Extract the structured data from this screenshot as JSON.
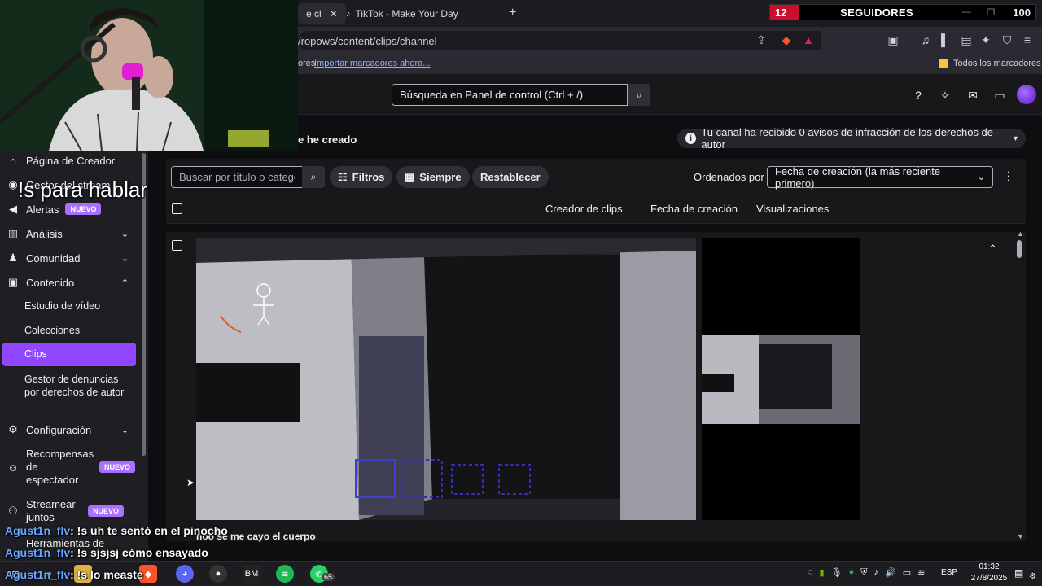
{
  "browser": {
    "tabs": [
      {
        "label": "e cl",
        "close": "✕"
      },
      {
        "label": "TikTok - Make Your Day"
      }
    ],
    "new_tab": "+",
    "url": "/ropows/content/clips/channel",
    "bookmarks_prefix": "ores",
    "bookmarks_import": "Importar marcadores ahora...",
    "bookmarks_all": "Todos los marcadores"
  },
  "followers_widget": {
    "count": "12",
    "label": "SEGUIDORES",
    "goal": "100",
    "minimize": "—",
    "restore": "❐"
  },
  "header": {
    "search_placeholder": "Búsqueda en Panel de control (Ctrl + /)"
  },
  "sidebar": {
    "items": [
      {
        "label": "Página de Creador",
        "icon": "home-icon"
      },
      {
        "label": "Gestor del stream",
        "icon": "broadcast-icon"
      },
      {
        "label": "Alertas",
        "icon": "megaphone-icon",
        "badge": "NUEVO"
      },
      {
        "label": "Análisis",
        "icon": "chart-icon"
      },
      {
        "label": "Comunidad",
        "icon": "community-icon"
      },
      {
        "label": "Contenido",
        "icon": "content-icon"
      }
    ],
    "content_sub": [
      "Estudio de vídeo",
      "Colecciones",
      "Clips",
      "Gestor de denuncias por derechos de autor"
    ],
    "config": "Configuración",
    "rewards": "Recompensas de espectador",
    "rewards_badge": "NUEVO",
    "together": "Streamear juntos",
    "together_badge": "NUEVO",
    "tools": "Herramientas de"
  },
  "main": {
    "section_title": "e he creado",
    "notice": "Tu canal ha recibido 0 avisos de infracción de los derechos de autor",
    "clip_search_placeholder": "Buscar por título o categoría",
    "filters": "Filtros",
    "period": "Siempre",
    "reset": "Restablecer",
    "sort_label": "Ordenados por",
    "sort_value": "Fecha de creación (la más reciente primero)",
    "columns": [
      "Creador de clips",
      "Fecha de creación",
      "Visualizaciones"
    ],
    "clip_title": "noo se me cayo el cuerpo"
  },
  "overlay": {
    "text": "!s para hablar"
  },
  "chat": [
    {
      "user": "Agust1n_flv",
      "msg": ": !s uh te sentó en el pinocho"
    },
    {
      "user": "Agust1n_flv",
      "msg": ": !s sjsjsj cómo ensayado"
    },
    {
      "user": "Agust1n_flv",
      "msg": ": !s lo measte"
    }
  ],
  "taskbar": {
    "lang": "ESP",
    "time": "01:32",
    "date": "27/8/2025",
    "whatsapp_count": "65"
  }
}
